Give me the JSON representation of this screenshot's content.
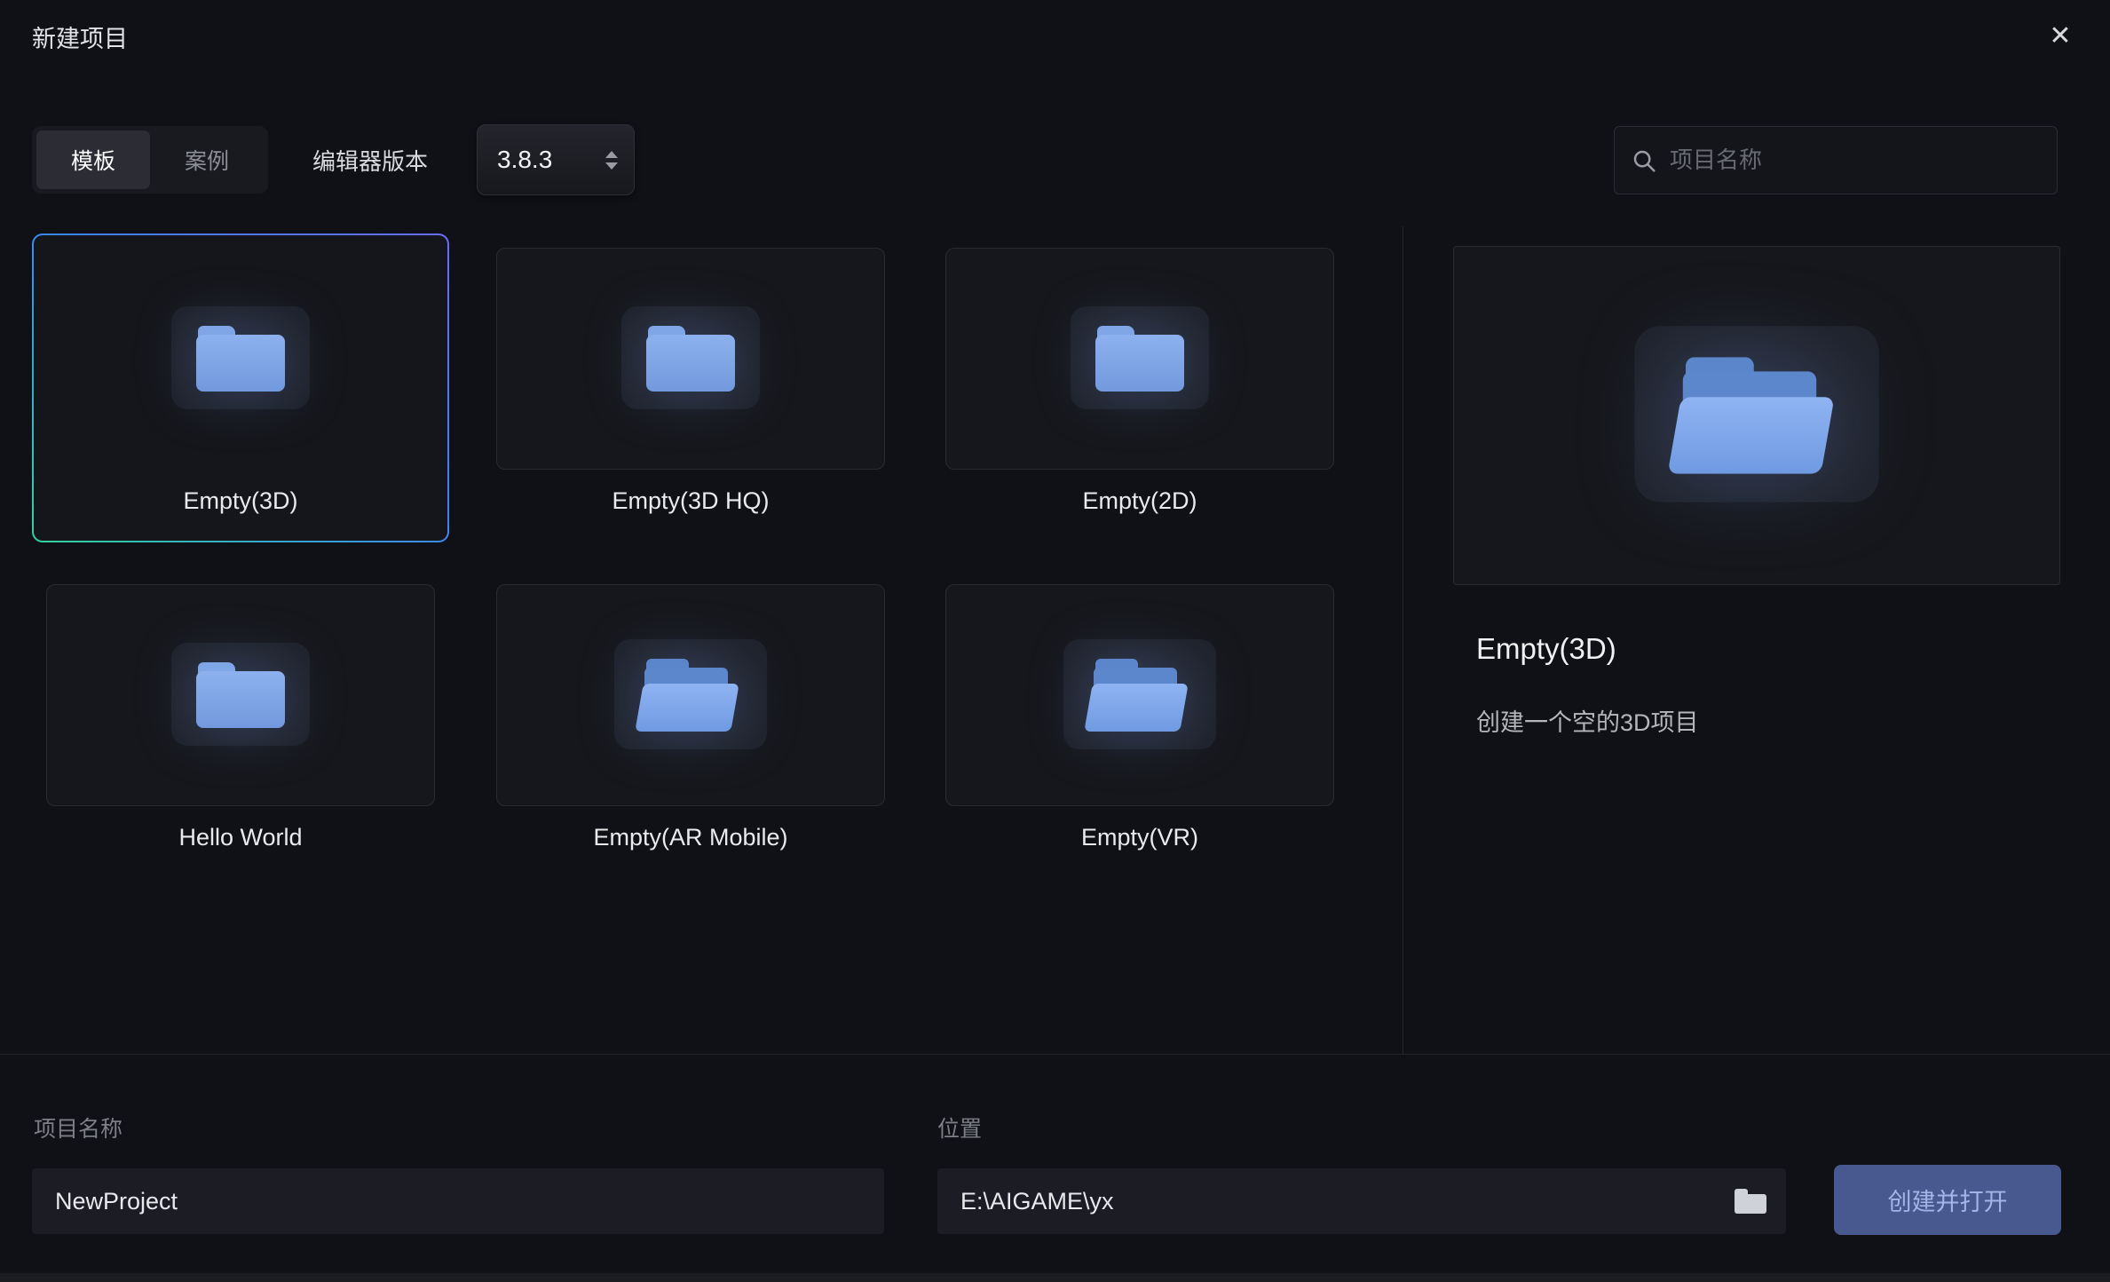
{
  "dialog": {
    "title": "新建项目",
    "close_icon": "✕"
  },
  "toolbar": {
    "tabs": [
      {
        "label": "模板"
      },
      {
        "label": "案例"
      }
    ],
    "active_tab": "模板",
    "version_label": "编辑器版本",
    "version_value": "3.8.3",
    "search_placeholder": "项目名称"
  },
  "templates": [
    {
      "label": "Empty(3D)",
      "icon": "folder-closed",
      "selected": true
    },
    {
      "label": "Empty(3D HQ)",
      "icon": "folder-closed",
      "selected": false
    },
    {
      "label": "Empty(2D)",
      "icon": "folder-closed",
      "selected": false
    },
    {
      "label": "Hello World",
      "icon": "folder-closed",
      "selected": false
    },
    {
      "label": "Empty(AR Mobile)",
      "icon": "folder-open",
      "selected": false
    },
    {
      "label": "Empty(VR)",
      "icon": "folder-open",
      "selected": false
    }
  ],
  "detail": {
    "title": "Empty(3D)",
    "description": "创建一个空的3D项目"
  },
  "footer": {
    "project_name_label": "项目名称",
    "project_name_value": "NewProject",
    "location_label": "位置",
    "location_value": "E:\\AIGAME\\yx",
    "create_button_label": "创建并打开"
  },
  "colors": {
    "background": "#101116",
    "card_background": "#16171c",
    "folder_blue": "#7fa6e6",
    "selected_border_blue": "#3b82f6",
    "selected_border_green": "#31d49c",
    "accent_button": "#47598f"
  }
}
